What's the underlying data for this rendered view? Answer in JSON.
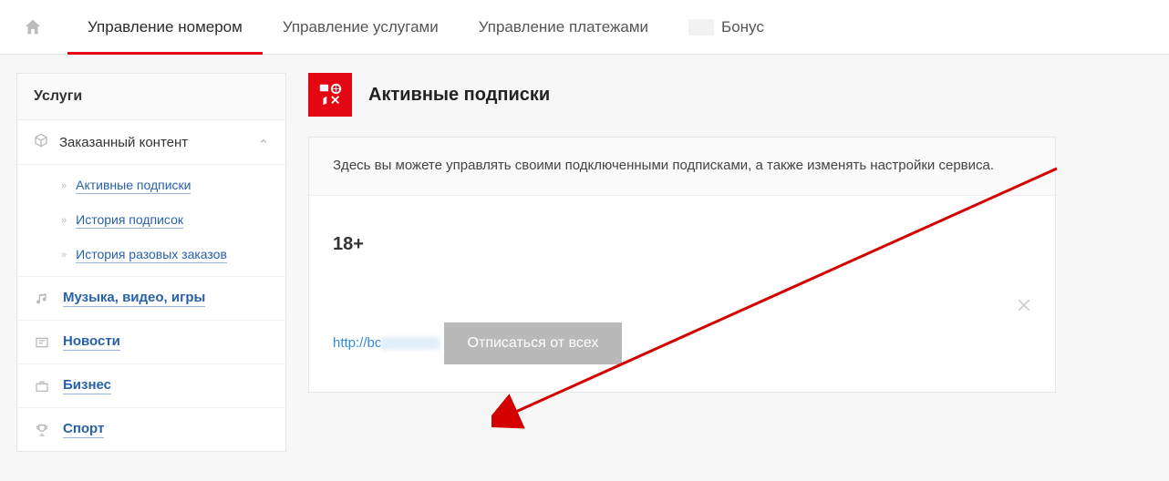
{
  "topnav": {
    "tabs": [
      {
        "label": "Управление номером",
        "active": true
      },
      {
        "label": "Управление услугами",
        "active": false
      },
      {
        "label": "Управление платежами",
        "active": false
      },
      {
        "label": "Бонус",
        "active": false
      }
    ]
  },
  "sidebar": {
    "header": "Услуги",
    "ordered_content": "Заказанный контент",
    "sub": {
      "active_subs": "Активные подписки",
      "history_subs": "История подписок",
      "history_single": "История разовых заказов"
    },
    "cats": {
      "media": "Музыка, видео, игры",
      "news": "Новости",
      "business": "Бизнес",
      "sport": "Спорт"
    }
  },
  "page": {
    "title": "Активные подписки",
    "info": "Здесь вы можете управлять своими подключенными подписками, а также изменять настройки сервиса."
  },
  "item": {
    "title": "18+",
    "link_prefix": "http://bc"
  },
  "buttons": {
    "unsubscribe_all": "Отписаться от всех"
  }
}
